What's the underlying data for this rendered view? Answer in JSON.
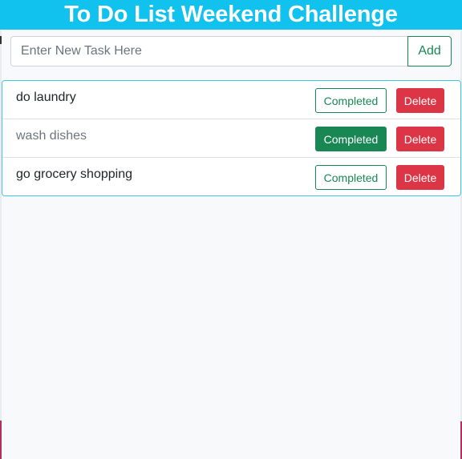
{
  "header": {
    "title": "To Do List Weekend Challenge"
  },
  "new_task": {
    "placeholder": "Enter New Task Here",
    "value": "",
    "add_label": "Add"
  },
  "tasks": [
    {
      "name": "do laundry",
      "completed": false,
      "complete_label": "Completed",
      "delete_label": "Delete"
    },
    {
      "name": "wash dishes",
      "completed": true,
      "complete_label": "Completed",
      "delete_label": "Delete"
    },
    {
      "name": "go grocery shopping",
      "completed": false,
      "complete_label": "Completed",
      "delete_label": "Delete"
    }
  ],
  "colors": {
    "header_bg": "#11c2ef",
    "success": "#198754",
    "danger": "#dc3545",
    "list_border": "#3fc8e6"
  }
}
